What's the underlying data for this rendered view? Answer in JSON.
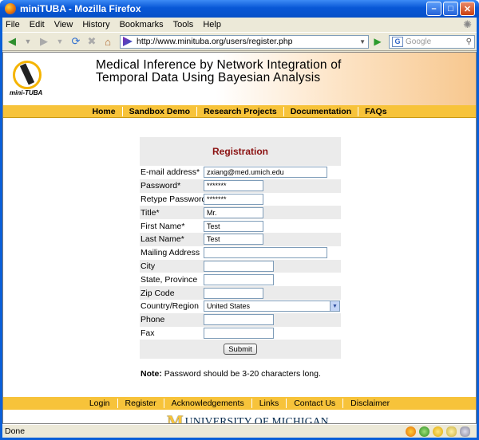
{
  "window": {
    "title": "miniTUBA - Mozilla Firefox"
  },
  "menu": [
    "File",
    "Edit",
    "View",
    "History",
    "Bookmarks",
    "Tools",
    "Help"
  ],
  "nav": {
    "url": "http://www.minituba.org/users/register.php",
    "search_placeholder": "Google"
  },
  "site": {
    "logo_text": "mini-TUBA",
    "headline_1": "Medical Inference by Network Integration of",
    "headline_2": "Temporal Data Using Bayesian Analysis",
    "top_nav": [
      "Home",
      "Sandbox Demo",
      "Research Projects",
      "Documentation",
      "FAQs"
    ]
  },
  "form": {
    "title": "Registration",
    "fields": [
      {
        "label": "E-mail address*",
        "value": "zxiang@med.umich.edu"
      },
      {
        "label": "Password*",
        "value": "*******"
      },
      {
        "label": "Retype Password*",
        "value": "*******"
      },
      {
        "label": "Title*",
        "value": "Mr."
      },
      {
        "label": "First Name*",
        "value": "Test"
      },
      {
        "label": "Last Name*",
        "value": "Test"
      },
      {
        "label": "Mailing Address",
        "value": ""
      },
      {
        "label": "City",
        "value": ""
      },
      {
        "label": "State, Province",
        "value": ""
      },
      {
        "label": "Zip Code",
        "value": ""
      },
      {
        "label": "Country/Region",
        "value": "United States"
      },
      {
        "label": "Phone",
        "value": ""
      },
      {
        "label": "Fax",
        "value": ""
      }
    ],
    "submit_label": "Submit",
    "note_label": "Note:",
    "note_text": "Password should be 3-20 characters long."
  },
  "footer_nav": [
    "Login",
    "Register",
    "Acknowledgements",
    "Links",
    "Contact Us",
    "Disclaimer"
  ],
  "footer_logo": {
    "m": "M",
    "text": "UNIVERSITY OF MICHIGAN"
  },
  "status": {
    "text": "Done"
  },
  "colors": {
    "nav_bar": "#f7c33a",
    "form_title": "#8b1212",
    "um_blue": "#00274c"
  }
}
